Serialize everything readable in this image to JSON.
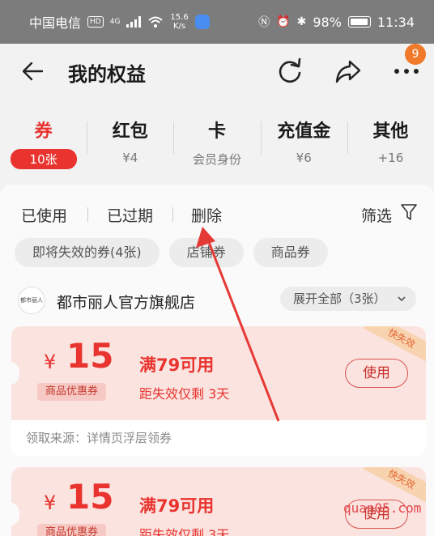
{
  "status_bar": {
    "carrier": "中国电信",
    "hd": "HD",
    "net": "4G",
    "speed_value": "15.6",
    "speed_unit": "K/s",
    "battery": "98%",
    "time": "11:34"
  },
  "header": {
    "title": "我的权益",
    "more_badge": "9"
  },
  "categories": [
    {
      "label": "券",
      "sub": "10张"
    },
    {
      "label": "红包",
      "sub": "¥4"
    },
    {
      "label": "卡",
      "sub": "会员身份"
    },
    {
      "label": "充值金",
      "sub": "¥6"
    },
    {
      "label": "其他",
      "sub": "+16"
    }
  ],
  "filters": {
    "used": "已使用",
    "expired": "已过期",
    "delete": "删除",
    "filter": "筛选"
  },
  "chips": [
    "即将失效的券(4张)",
    "店铺券",
    "商品券"
  ],
  "store": {
    "logo_text": "都市丽人",
    "name": "都市丽人官方旗舰店",
    "expand": "展开全部（3张）"
  },
  "coupons": [
    {
      "yen": "¥",
      "amount": "15",
      "type": "商品优惠券",
      "condition": "满79可用",
      "expire": "距失效仅剩 3天",
      "use": "使用",
      "tag": "快失效",
      "source": "领取来源：详情页浮层领券"
    },
    {
      "yen": "¥",
      "amount": "15",
      "type": "商品优惠券",
      "condition": "满79可用",
      "expire": "距失效仅剩 3天",
      "use": "使用",
      "tag": "快失效"
    }
  ],
  "watermark": "quan05.com"
}
